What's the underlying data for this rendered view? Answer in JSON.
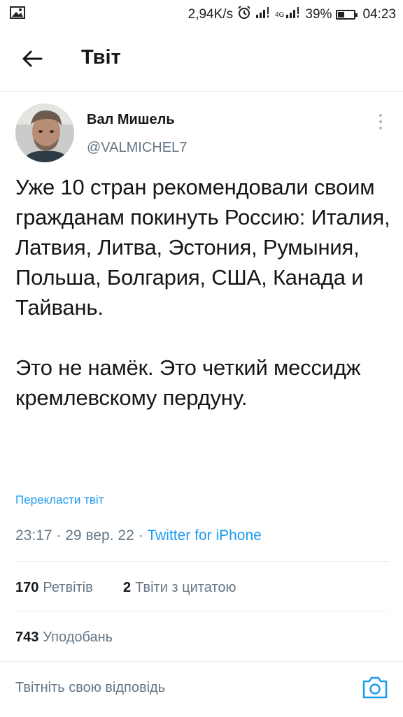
{
  "status_bar": {
    "net_speed": "2,94K/s",
    "net_type": "4G",
    "battery_percent": "39%",
    "battery_level": 0.39,
    "time": "04:23"
  },
  "header": {
    "title": "Твіт"
  },
  "tweet": {
    "author_name": "Вал Мишель",
    "author_handle": "@VALMICHEL7",
    "text": "Уже 10 стран рекомендовали своим гражданам покинуть Россию: Италия, Латвия, Литва, Эстония, Румыния, Польша, Болгария, США, Канада и Тайвань.\n\nЭто не намёк. Это четкий мессидж кремлевскому пердуну.",
    "translate_label": "Перекласти твіт",
    "time": "23:17",
    "date": "29 вер. 22",
    "separator": "·",
    "source": "Twitter for iPhone"
  },
  "stats": {
    "retweets_count": "170",
    "retweets_label": "Ретвітів",
    "quotes_count": "2",
    "quotes_label": "Твіти з цитатою",
    "likes_count": "743",
    "likes_label": "Уподобань"
  },
  "reply": {
    "placeholder": "Твітніть свою відповідь"
  },
  "colors": {
    "accent": "#1d9bf0",
    "secondary_text": "#657786",
    "primary_text": "#14171a",
    "divider": "#e6ecf0"
  }
}
